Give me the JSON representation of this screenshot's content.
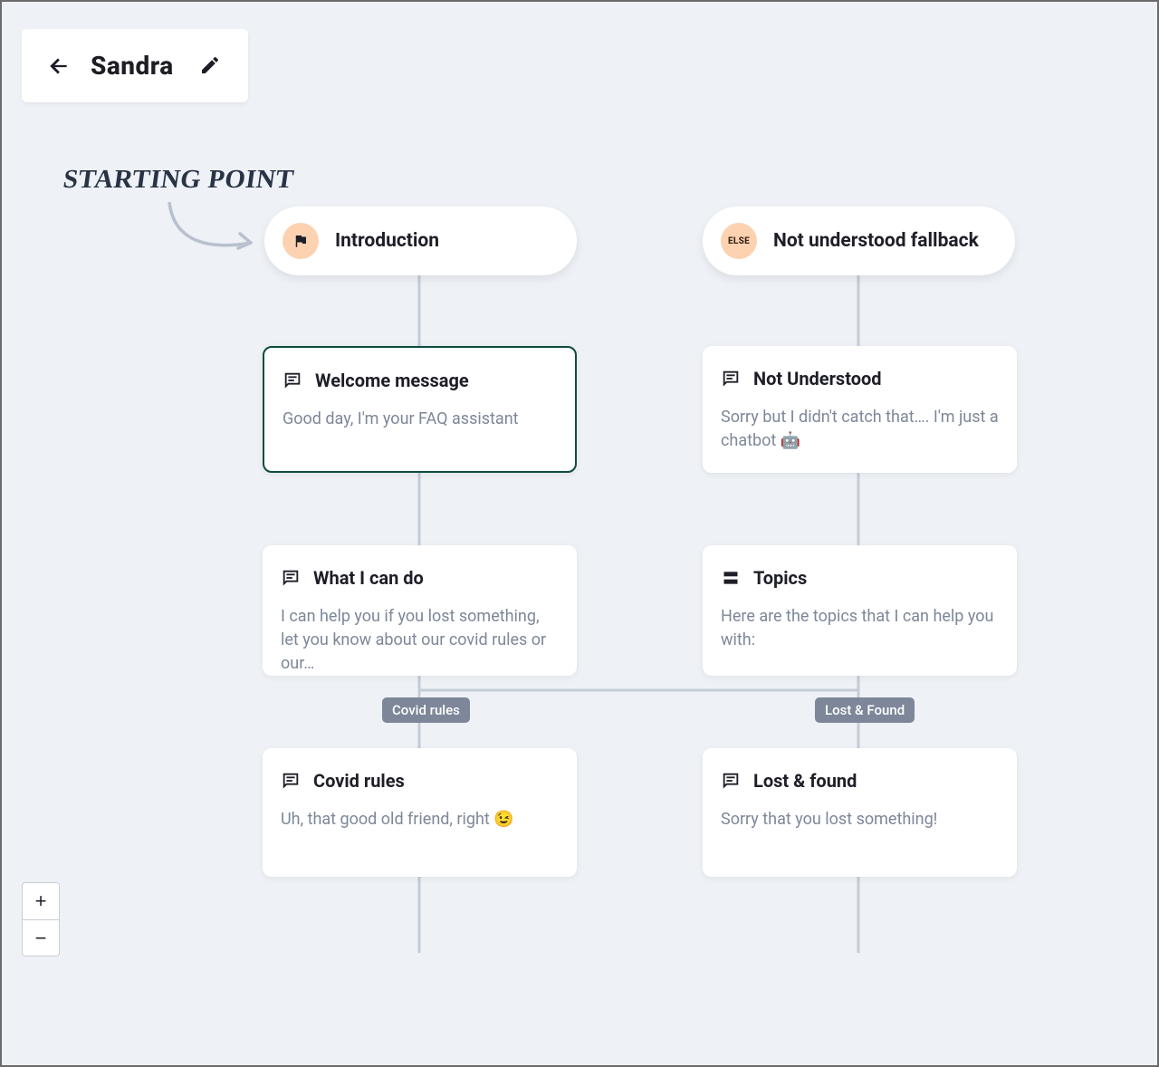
{
  "header": {
    "title": "Sandra"
  },
  "annotation": {
    "starting_point": "STARTING POINT"
  },
  "roots": {
    "introduction": {
      "label": "Introduction",
      "badge_kind": "flag"
    },
    "fallback": {
      "label": "Not understood fallback",
      "badge_text": "ELSE"
    }
  },
  "nodes": {
    "welcome": {
      "title": "Welcome message",
      "body": "Good day, I'm your FAQ assistant",
      "icon": "chat",
      "selected": true
    },
    "whaticando": {
      "title": "What I can do",
      "body": "I can help you if you lost something, let you know about our covid rules or our…",
      "icon": "chat"
    },
    "notunder": {
      "title": "Not Understood",
      "body": "Sorry but I didn't catch that…. I'm just a chatbot 🤖",
      "icon": "chat"
    },
    "topics": {
      "title": "Topics",
      "body": "Here are the topics that I can help you with:",
      "icon": "list"
    },
    "covid": {
      "title": "Covid rules",
      "body": "Uh, that good old friend, right 😉",
      "icon": "chat"
    },
    "lost": {
      "title": "Lost & found",
      "body": "Sorry that you lost something!",
      "icon": "chat"
    }
  },
  "branch_tags": {
    "covid": "Covid rules",
    "lost": "Lost & Found"
  }
}
